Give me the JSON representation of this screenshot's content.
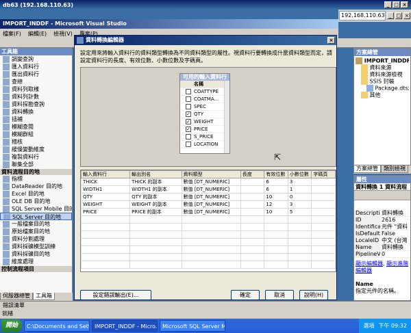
{
  "remote": {
    "title": "db63 (192.168.110.63)",
    "ip": "192.168.110.63"
  },
  "vs": {
    "title": "IMPORT_INDDF - Microsoft Visual Studio",
    "menu": [
      "檔案(F)",
      "編輯(E)",
      "檢視(V)",
      "專案(P)"
    ]
  },
  "toolbox": {
    "header": "工具箱",
    "items_top": [
      "調變查詢",
      "匯入資料行",
      "匯出資料行",
      "查總",
      "資料列取樣",
      "資料列計數",
      "資料探勘查詢",
      "資料轉換",
      "插補",
      "模糊查閱",
      "模糊群組",
      "稽核",
      "緩慢變動維度",
      "複製資料行",
      "聯集全部"
    ],
    "section_dest": "資料流程目的地",
    "items_dest": [
      "指標",
      "DataReader 目的地",
      "Excel 目的地",
      "OLE DB 目的地",
      "SQL Server Mobile 目的地",
      "SQL Server 目的地",
      "一般檔案目的地",
      "原始檔案目的地",
      "資料分割處理",
      "資料採礦模型訓練",
      "資料採礦目的地",
      "維度處理"
    ],
    "section_ctrl": "控制流程項目",
    "tabs": [
      "伺服器總管",
      "工具箱"
    ]
  },
  "solution": {
    "header": "方案總管",
    "items": [
      "IMPORT_INDDF",
      "資料來源",
      "資料來源檢視",
      "SSIS 封裝",
      "Package.dtsx",
      "其他"
    ],
    "tabs": [
      "方案總管",
      "類別檢視"
    ]
  },
  "properties": {
    "header": "屬性",
    "object": "資料轉換 1 資料流程",
    "rows": [
      {
        "k": "Description",
        "v": "資料轉換"
      },
      {
        "k": "ID",
        "v": "2616"
      },
      {
        "k": "IdentificationString",
        "v": "元件 \"資料"
      },
      {
        "k": "IsDefaultLocale",
        "v": "False"
      },
      {
        "k": "LocaleID",
        "v": "中文 (台灣"
      },
      {
        "k": "Name",
        "v": "資料轉換"
      },
      {
        "k": "PipelineVersion",
        "v": "0"
      }
    ],
    "link1": "顯示編輯器",
    "link2": "顯示進階編輯器",
    "desc_title": "Name",
    "desc_text": "指定元件的名稱。"
  },
  "dialog": {
    "title": "資料轉換編輯器",
    "description": "設定用來將輸入資料行的資料類型轉換為不同資料類型的屬性。視資料行要轉換成什麼資料類型而定，請設定資料行的長度、有效位數、小數位數及字碼頁。",
    "available": {
      "caption": "可用的輸入資料行",
      "header": "名稱",
      "rows": [
        {
          "name": "COATTYPE",
          "checked": false
        },
        {
          "name": "COATMA...",
          "checked": false
        },
        {
          "name": "SPEC",
          "checked": false
        },
        {
          "name": "QTY",
          "checked": true
        },
        {
          "name": "WEIGHT",
          "checked": true
        },
        {
          "name": "PRICE",
          "checked": true
        },
        {
          "name": "S_PRICE",
          "checked": false
        },
        {
          "name": "LOCATION",
          "checked": false
        }
      ]
    },
    "grid": {
      "headers": [
        "輸入資料行",
        "輸出別名",
        "資料類型",
        "長度",
        "有效位數",
        "小數位數",
        "字碼頁"
      ],
      "rows": [
        [
          "THICK",
          "THICK 的副本",
          "數值 [DT_NUMERIC]",
          "",
          "6",
          "3",
          ""
        ],
        [
          "WIDTH1",
          "WIDTH1 的副本",
          "數值 [DT_NUMERIC]",
          "",
          "6",
          "1",
          ""
        ],
        [
          "QTY",
          "QTY 的副本",
          "數值 [DT_NUMERIC]",
          "",
          "10",
          "0",
          ""
        ],
        [
          "WEIGHT",
          "WEIGHT 的副本",
          "數值 [DT_NUMERIC]",
          "",
          "12",
          "3",
          ""
        ],
        [
          "PRICE",
          "PRICE 的副本",
          "數值 [DT_NUMERIC]",
          "",
          "10",
          "5",
          ""
        ]
      ]
    },
    "buttons": {
      "error_output": "設定錯誤輸出(E)...",
      "ok": "確定",
      "cancel": "取消",
      "help": "說明(H)"
    }
  },
  "bottom": {
    "error_tab": "錯誤清單",
    "status": "就緒"
  },
  "taskbar": {
    "start": "開始",
    "tasks": [
      "C:\\Documents and Setting...",
      "IMPORT_INDDF - Micro...",
      "Microsoft SQL Server Ma..."
    ],
    "tray_label": "選項",
    "clock": "下午 09:32"
  }
}
